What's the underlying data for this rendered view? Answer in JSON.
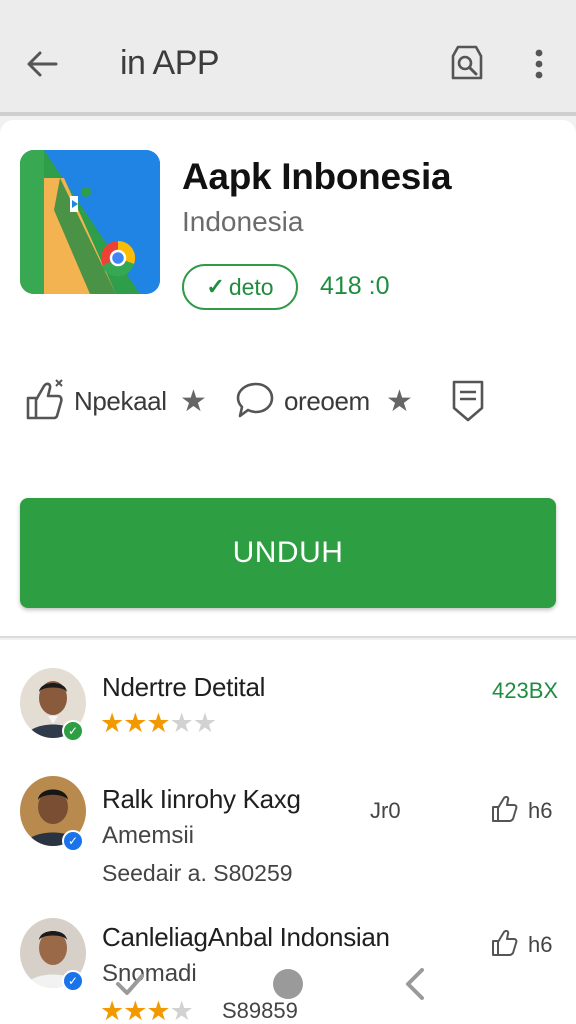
{
  "toolbar": {
    "title": "in APP",
    "back_icon": "arrow-left-icon",
    "search_icon": "app-search-icon",
    "more_icon": "more-vertical-icon"
  },
  "app": {
    "name": "Aapk Inbonesia",
    "publisher": "Indonesia",
    "badge_label": "deto",
    "size_info": "418 :0"
  },
  "stats": {
    "installs_label": "Npekaal",
    "reviews_label": "oreoem"
  },
  "install_button": {
    "label": "UNDUH"
  },
  "reviews": [
    {
      "name": "Ndertre Detital",
      "meta": "423BX",
      "rating": 3,
      "max": 5
    },
    {
      "name": "Ralk Iinrohy Kaxg",
      "subtitle": "Amemsii",
      "detail": "Seedair a. S80259",
      "meta_left": "Jr0",
      "meta_right": "h6"
    },
    {
      "name": "CanleliagAnbal  Indonsian",
      "subtitle": "Snomadi",
      "detail": "S89859",
      "meta_right": "h6",
      "rating": 3.5,
      "max": 5
    }
  ],
  "colors": {
    "accent": "#2e9e42",
    "star": "#f29900",
    "header_bg": "#ececec"
  },
  "navbar": {
    "icons": [
      "nav-check-icon",
      "nav-home-icon",
      "nav-back-icon"
    ]
  }
}
